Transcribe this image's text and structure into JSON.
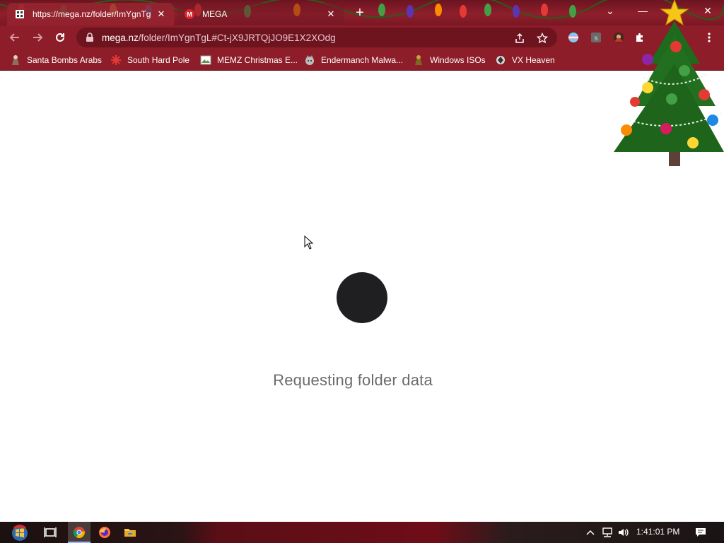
{
  "browser": {
    "tabs": [
      {
        "title": "https://mega.nz/folder/ImYgnTgL",
        "close": "✕",
        "active": true
      },
      {
        "title": "MEGA",
        "close": "✕",
        "active": false
      }
    ],
    "new_tab": "+",
    "window_controls": {
      "tab_search": "⌄",
      "minimize": "—",
      "close": "✕"
    },
    "url": {
      "host": "mega.nz",
      "path": "/folder/ImYgnTgL#Ct-jX9JRTQjJO9E1X2XOdg"
    },
    "theme": {
      "frame": "#8c1d29",
      "omnibox": "#6e141f"
    }
  },
  "bookmarks": [
    {
      "label": "Santa Bombs Arabs",
      "icon": "person-icon"
    },
    {
      "label": "South Hard Pole",
      "icon": "snowflake-icon"
    },
    {
      "label": "MEMZ Christmas E...",
      "icon": "image-icon"
    },
    {
      "label": "Endermanch Malwa...",
      "icon": "wolf-icon"
    },
    {
      "label": "Windows ISOs",
      "icon": "figure-icon"
    },
    {
      "label": "VX Heaven",
      "icon": "emblem-icon"
    }
  ],
  "page": {
    "loading_text": "Requesting folder data",
    "loader_color": "#1f1f21"
  },
  "taskbar": {
    "clock": "1:41:01 PM"
  }
}
